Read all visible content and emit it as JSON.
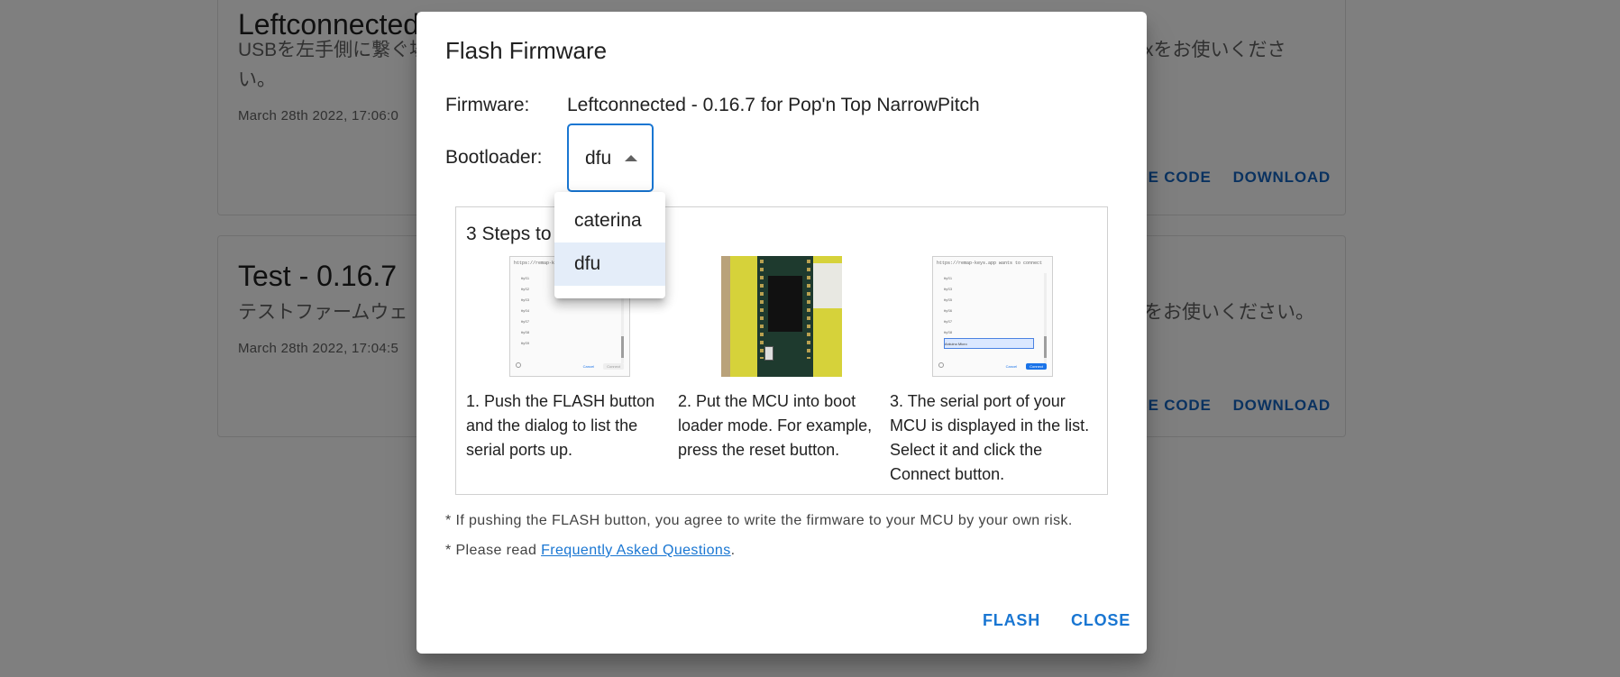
{
  "background": {
    "cards": [
      {
        "title": "Leftconnected",
        "description_line1": "USBを左手側に繋ぐ場",
        "description_line1_right": "xをお使いくださ",
        "description_line2": "い。",
        "date": "March 28th 2022, 17:06:0",
        "source_code_label": "RCE CODE",
        "download_label": "DOWNLOAD"
      },
      {
        "title": "Test - 0.16.7",
        "description_line1": "テストファームウェ",
        "description_line1_right": "をお使いください。",
        "date": "March 28th 2022, 17:04:5",
        "source_code_label": "RCE CODE",
        "download_label": "DOWNLOAD"
      }
    ]
  },
  "dialog": {
    "title": "Flash Firmware",
    "firmware_label": "Firmware:",
    "firmware_value": "Leftconnected - 0.16.7 for Pop'n Top NarrowPitch",
    "bootloader_label": "Bootloader:",
    "bootloader_value": "dfu",
    "bootloader_options": [
      "caterina",
      "dfu"
    ],
    "steps_title": "3 Steps to",
    "steps": [
      {
        "text": "1. Push the FLASH button and the dialog to list the serial ports up.",
        "image": "serial-port-dialog-screenshot"
      },
      {
        "text": "2. Put the MCU into boot loader mode. For example, press the reset button.",
        "image": "mcu-board-photo"
      },
      {
        "text": "3. The serial port of your MCU is displayed in the list. Select it and click the Connect button.",
        "image": "serial-port-selected-screenshot"
      }
    ],
    "note1": "* If pushing the FLASH button, you agree to write the firmware to your MCU by your own risk.",
    "note2_prefix": "* Please read ",
    "note2_link": "Frequently Asked Questions",
    "note2_suffix": ".",
    "flash_label": "FLASH",
    "close_label": "CLOSE"
  },
  "colors": {
    "accent": "#1976d2",
    "backdrop": "rgba(0,0,0,0.5)",
    "menu_selected": "#e4edf9"
  }
}
